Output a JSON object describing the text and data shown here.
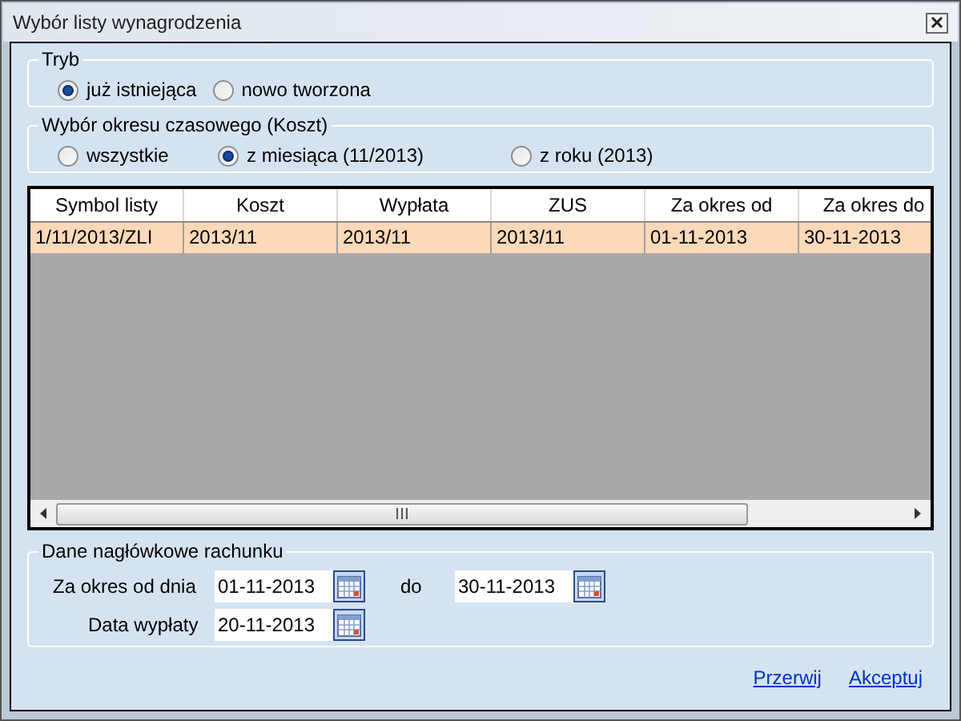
{
  "window": {
    "title": "Wybór listy wynagrodzenia"
  },
  "mode": {
    "label": "Tryb",
    "options": [
      {
        "label": "już istniejąca",
        "selected": true
      },
      {
        "label": "nowo tworzona",
        "selected": false
      }
    ]
  },
  "period": {
    "label": "Wybór okresu czasowego (Koszt)",
    "options": [
      {
        "label": "wszystkie",
        "selected": false
      },
      {
        "label": "z miesiąca (11/2013)",
        "selected": true
      },
      {
        "label": "z roku (2013)",
        "selected": false
      }
    ]
  },
  "table": {
    "columns": [
      "Symbol listy",
      "Koszt",
      "Wypłata",
      "ZUS",
      "Za okres od",
      "Za okres do"
    ],
    "rows": [
      {
        "cells": [
          "1/11/2013/ZLI",
          "2013/11",
          "2013/11",
          "2013/11",
          "01-11-2013",
          "30-11-2013"
        ],
        "selected": true
      }
    ]
  },
  "header_data": {
    "label": "Dane nagłówkowe rachunku",
    "period_label": "Za okres od dnia",
    "period_from": "01-11-2013",
    "to_label": "do",
    "period_to": "30-11-2013",
    "payout_label": "Data wypłaty",
    "payout_date": "20-11-2013"
  },
  "links": [
    "Przerwij",
    "Akceptuj"
  ]
}
